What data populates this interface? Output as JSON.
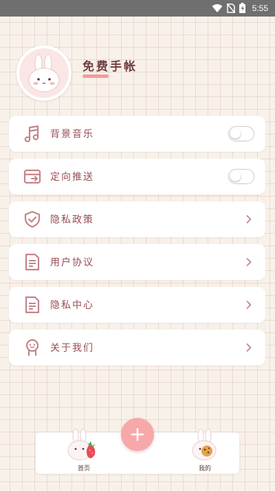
{
  "status_bar": {
    "time": "5:55"
  },
  "profile": {
    "title": "免费手帐"
  },
  "menu": [
    {
      "label": "背景音乐",
      "icon": "music-note-icon",
      "control": "toggle",
      "toggle_on": false
    },
    {
      "label": "定向推送",
      "icon": "push-card-icon",
      "control": "toggle",
      "toggle_on": false
    },
    {
      "label": "隐私政策",
      "icon": "shield-check-icon",
      "control": "chevron"
    },
    {
      "label": "用户协议",
      "icon": "document-icon",
      "control": "chevron"
    },
    {
      "label": "隐私中心",
      "icon": "document-icon",
      "control": "chevron"
    },
    {
      "label": "关于我们",
      "icon": "person-icon",
      "control": "chevron"
    }
  ],
  "bottom_nav": {
    "left_label": "首页",
    "right_label": "我的",
    "fab_icon": "plus-icon"
  },
  "colors": {
    "accent_pink": "#f7a9aa",
    "label_text": "#9a4c54",
    "icon_color": "#c4848a",
    "title_text": "#6f3f3f"
  }
}
